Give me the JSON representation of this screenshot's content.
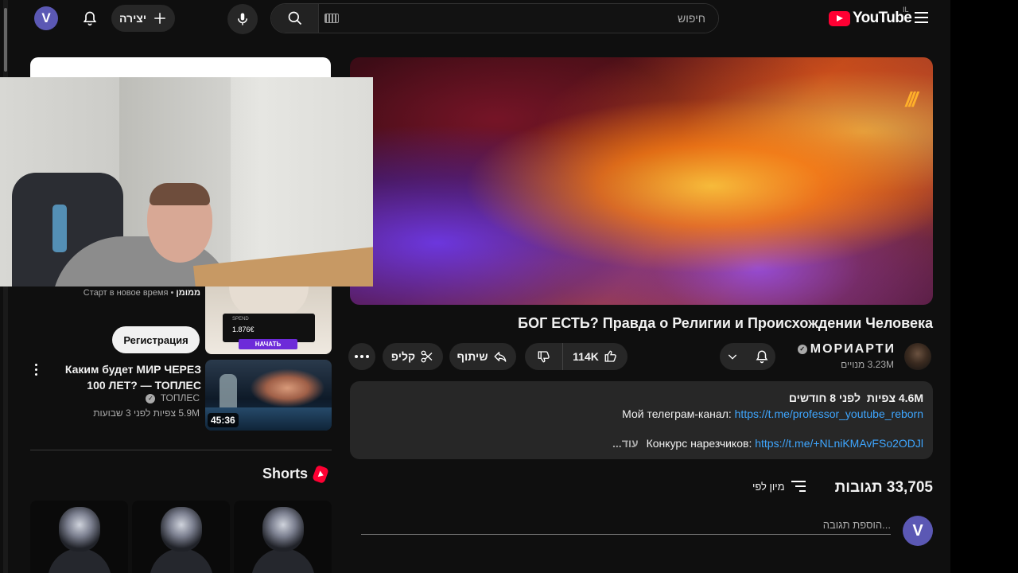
{
  "topbar": {
    "user_initial": "V",
    "create_label": "יצירה",
    "search_placeholder": "חיפוש",
    "logo_text": "YouTube",
    "region": "IL"
  },
  "video": {
    "title": "БОГ ЕСТЬ? Правда о Религии и Происхождении Человека",
    "channel_name": "МОРИАРТИ",
    "subscribers": "3.23M מנויים",
    "likes": "114K",
    "share_label": "שיתוף",
    "clip_label": "קליפ",
    "player_mark": "///"
  },
  "description": {
    "views": "4.6M צפיות",
    "age": "לפני 8 חודשים",
    "line1_text": "Мой телеграм-канал:",
    "line1_link": "https://t.me/professor_youtube_reborn",
    "line2_text": "Конкурс нарезчиков:",
    "line2_link": "https://t.me/+NLniKMAvFSo2ODJl",
    "more_label": "...עוד"
  },
  "comments": {
    "count": "33,705 תגובות",
    "sort_label": "מיון לפי",
    "input_placeholder": "הוספת תגובה...",
    "user_initial": "V"
  },
  "ad": {
    "sponsored": "ממומן",
    "tagline": "Старт в новое время",
    "register_label": "Регистрация",
    "spend_label": "SPEND",
    "spend_value": "1.876€",
    "start_label": "НАЧАТЬ"
  },
  "recommendation": {
    "title": "Каким будет МИР ЧЕРЕЗ 100 ЛЕТ? — ТОПЛЕС",
    "channel": "ТОПЛЕС",
    "views": "5.9M צפיות",
    "age": "לפני 3 שבועות",
    "duration": "45:36"
  },
  "shorts": {
    "title": "Shorts"
  },
  "colors": {
    "background": "#0f0f0f",
    "pill": "#272727",
    "accent_red": "#ff0033",
    "link_blue": "#3ea6ff",
    "avatar": "#5b58b4"
  }
}
